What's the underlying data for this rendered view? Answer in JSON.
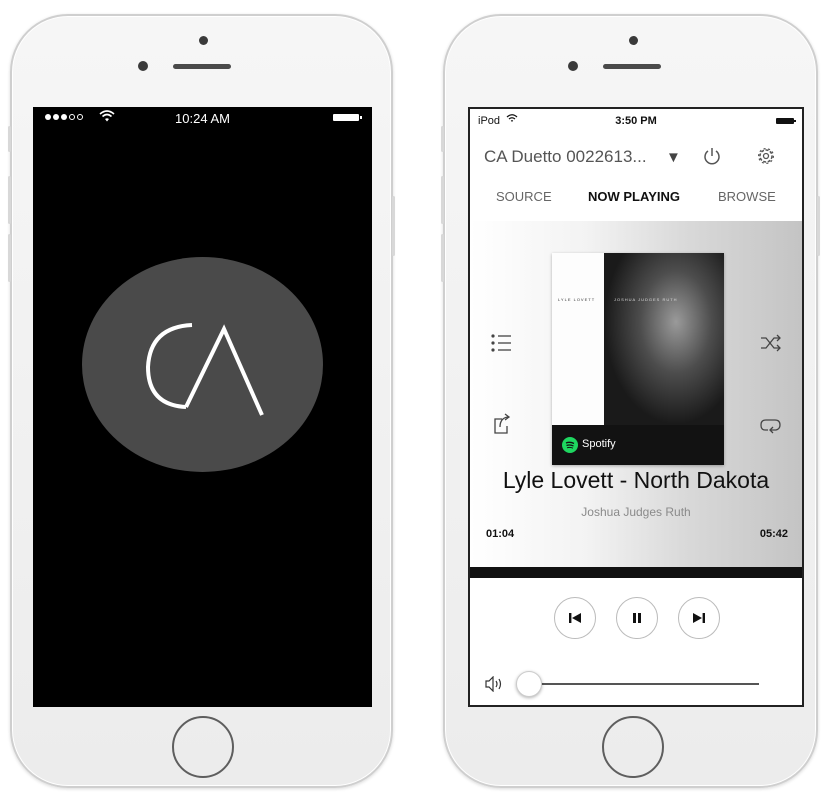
{
  "left_phone": {
    "status_bar": {
      "time": "10:24 AM",
      "signal_icon": "signal-dots-icon",
      "wifi_icon": "wifi-icon",
      "battery_icon": "battery-icon"
    },
    "splash": {
      "logo_text": "CA",
      "logo_icon": "ca-logo-icon",
      "circle_color": "#4a4a4a"
    }
  },
  "right_phone": {
    "status_bar": {
      "carrier": "iPod",
      "time": "3:50 PM",
      "wifi_icon": "wifi-icon",
      "battery_icon": "battery-icon"
    },
    "header": {
      "device_name": "CA Duetto 0022613...",
      "dropdown_icon": "dropdown-caret-icon",
      "power_icon": "power-icon",
      "settings_icon": "gear-icon"
    },
    "tabs": [
      {
        "label": "SOURCE",
        "active": false
      },
      {
        "label": "NOW PLAYING",
        "active": true
      },
      {
        "label": "BROWSE",
        "active": false
      }
    ],
    "now_playing": {
      "track_title": "Lyle Lovett - North Dakota",
      "album_title": "Joshua Judges Ruth",
      "elapsed": "01:04",
      "total": "05:42",
      "service_name": "Spotify",
      "service_color": "#1ed760",
      "album_cover_text_left": "LYLE LOVETT",
      "album_cover_text_right": "JOSHUA JUDGES RUTH",
      "progress_fraction": 0.19
    },
    "side_controls": {
      "left_top_icon": "queue-list-icon",
      "left_bottom_icon": "share-icon",
      "right_top_icon": "shuffle-icon",
      "right_bottom_icon": "repeat-icon"
    },
    "transport": {
      "prev_icon": "skip-previous-icon",
      "pause_icon": "pause-icon",
      "next_icon": "skip-next-icon"
    },
    "volume": {
      "icon": "speaker-icon",
      "level": 0.0
    }
  }
}
